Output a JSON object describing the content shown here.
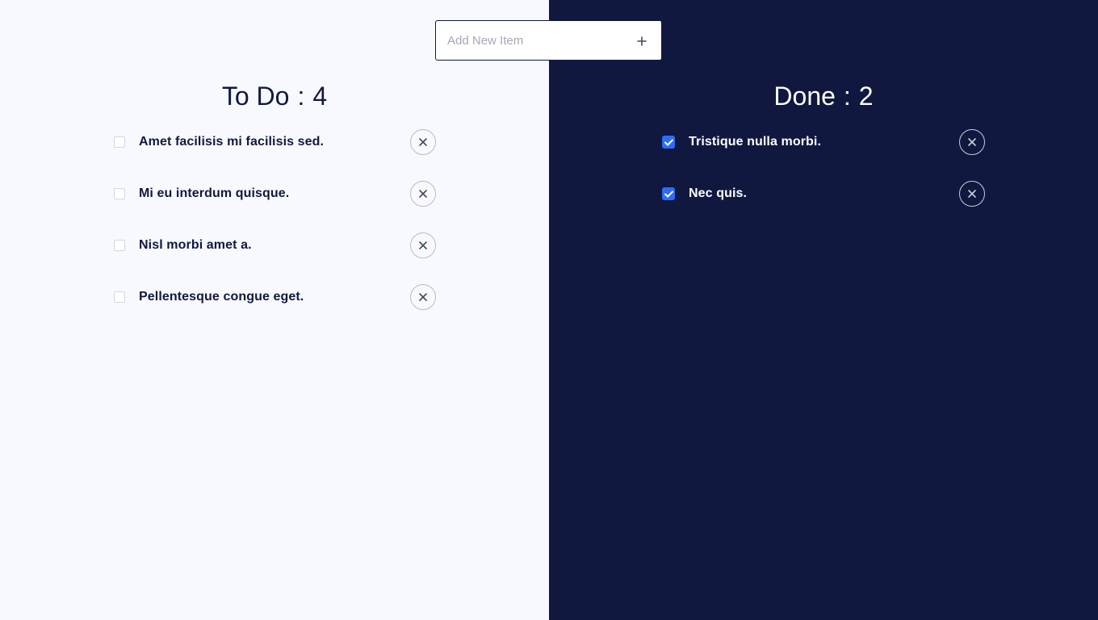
{
  "add_item": {
    "placeholder": "Add New Item",
    "button_icon": "plus-icon"
  },
  "todo": {
    "label": "To Do",
    "separator": ":",
    "count": "4",
    "items": [
      {
        "label": "Amet facilisis mi facilisis sed.",
        "checked": false
      },
      {
        "label": "Mi eu interdum quisque.",
        "checked": false
      },
      {
        "label": "Nisl morbi amet a.",
        "checked": false
      },
      {
        "label": "Pellentesque congue eget.",
        "checked": false
      }
    ]
  },
  "done": {
    "label": "Done",
    "separator": ":",
    "count": "2",
    "items": [
      {
        "label": "Tristique nulla morbi.",
        "checked": true
      },
      {
        "label": "Nec quis.",
        "checked": true
      }
    ]
  },
  "colors": {
    "light_panel": "#f8f9fe",
    "dark_panel": "#11183f",
    "accent": "#2f6cf6"
  },
  "icons": {
    "remove": "close-icon",
    "checked": "check-icon"
  }
}
